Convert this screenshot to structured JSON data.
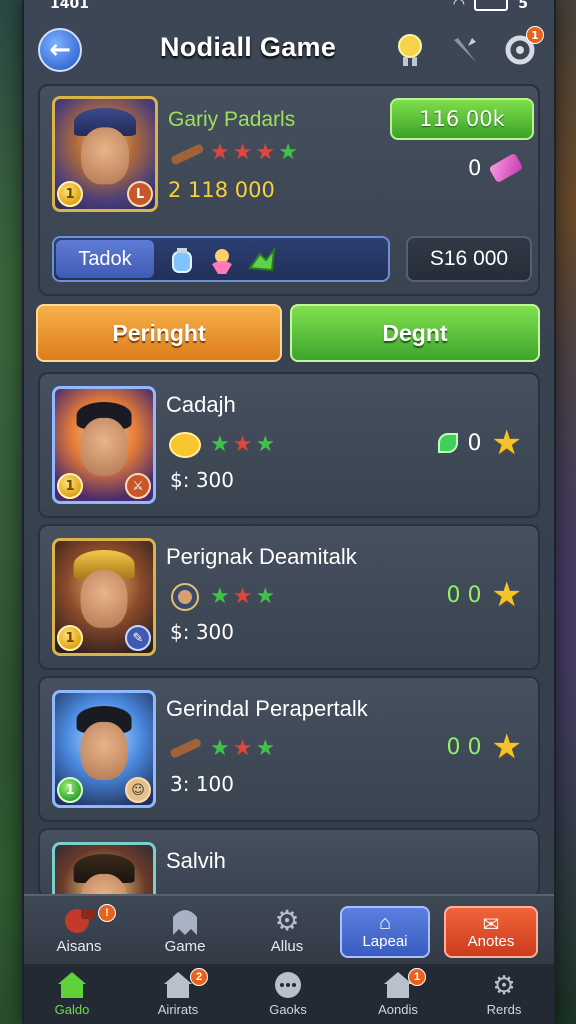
{
  "status": {
    "time": "1401",
    "battery": "5"
  },
  "header": {
    "title": "Nodiall Game",
    "notif_badge": "1"
  },
  "profile": {
    "name": "Gariy Padarls",
    "gold": "2 118 000",
    "green_pill": "116 00k",
    "gems": "0",
    "inventory_label": "Tadok",
    "value_box": "S16 000",
    "level": "1",
    "corner": "L"
  },
  "actions": {
    "left": "Peringht",
    "right": "Degnt"
  },
  "list": [
    {
      "name": "Cadajh",
      "price": "$: 300",
      "count": "0",
      "level": "1"
    },
    {
      "name": "Perignak Deamitalk",
      "price": "$: 300",
      "count": "0 0",
      "level": "1"
    },
    {
      "name": "Gerindal Perapertalk",
      "price": "3: 100",
      "count": "0 0",
      "level": "1"
    },
    {
      "name": "Salvih"
    }
  ],
  "tabs": [
    {
      "label": "Aisans",
      "icon": "cannon-icon",
      "badge": "!"
    },
    {
      "label": "Game",
      "icon": "ghost-icon"
    },
    {
      "label": "Allus",
      "icon": "gear-icon"
    },
    {
      "label": "Lapeai",
      "icon": "house-icon"
    },
    {
      "label": "Anotes",
      "icon": "scroll-icon"
    }
  ],
  "nav": [
    {
      "label": "Galdo",
      "icon": "home-icon"
    },
    {
      "label": "Airirats",
      "icon": "barn-icon",
      "badge": "2"
    },
    {
      "label": "Gaoks",
      "icon": "dots-icon"
    },
    {
      "label": "Aondis",
      "icon": "house-icon",
      "badge": "1"
    },
    {
      "label": "Rerds",
      "icon": "gear-icon"
    }
  ],
  "colors": {
    "accent_green": "#3ba52e",
    "accent_orange": "#dd7d1c",
    "gold": "#f4d23c"
  }
}
